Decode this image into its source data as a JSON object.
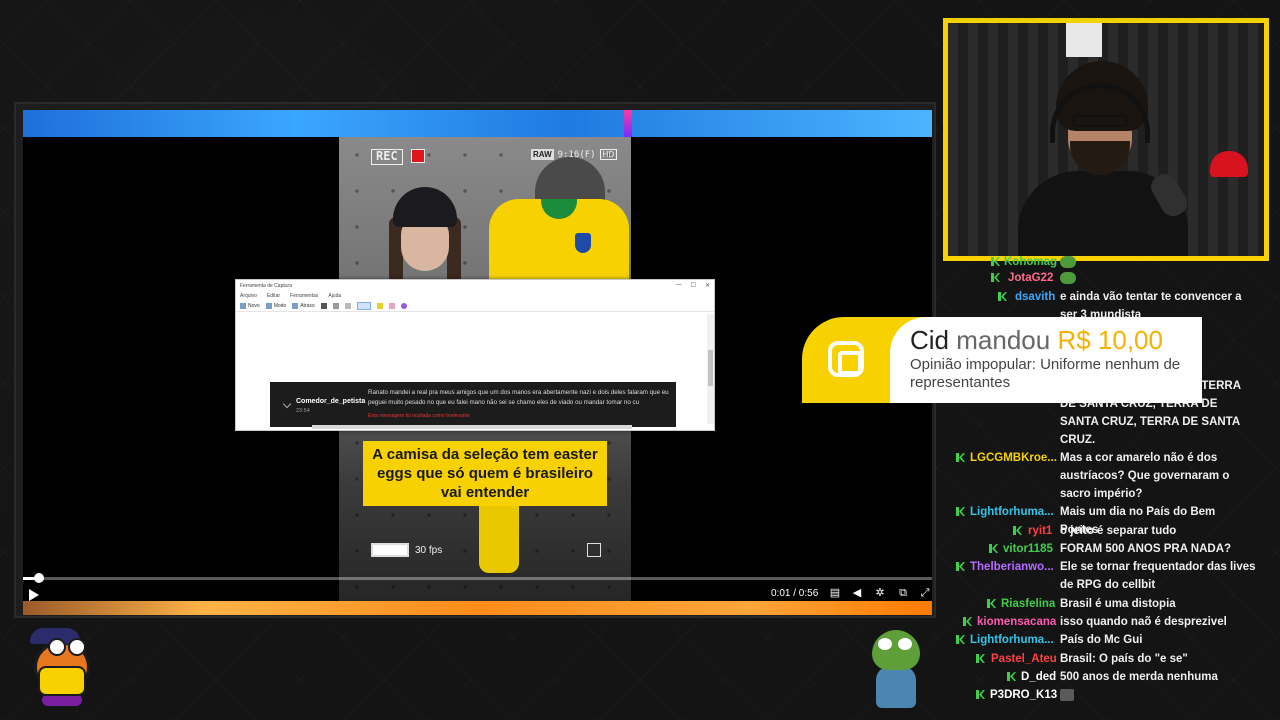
{
  "player": {
    "time": "0:01 / 0:56",
    "progress": 0.018
  },
  "clip": {
    "rec_label": "REC",
    "raw_label": "RAW",
    "fps_top": "9:16(F)",
    "hd_label": "HD",
    "caption": "A camisa da seleção tem easter eggs que só quem é brasileiro vai entender",
    "fps_bottom": "30 fps"
  },
  "snip": {
    "title": "Ferramenta de Captura",
    "menu": [
      "Arquivo",
      "Editar",
      "Ferramentas",
      "Ajuda"
    ],
    "toolbar": {
      "new": "Novo",
      "mode": "Modo",
      "delay": "Atraso"
    },
    "comment": {
      "user": "Comedor_de_petista",
      "date": "23:54",
      "text": "Ranato mandei a real pra meus amigos que um dos manos era abertamente nazi e dois deles falaram que eu peguei muito pesado no que eu falei mano não sei se chamo eles de viado ou mandar tomar no cu",
      "note": "Esta mensagem foi ocultada como Irrelevante"
    }
  },
  "alert": {
    "name": "Cid",
    "verb": "mandou",
    "amount": "R$ 10,00",
    "message": "Opinião impopular: Uniforme nenhum de representantes"
  },
  "chat": [
    {
      "user": "Kohomag",
      "color": "#3ecf4c",
      "text": ""
    },
    {
      "user": "JotaG22",
      "color": "#ff6a8a",
      "text": ""
    },
    {
      "user": "dsavith",
      "color": "#39a8ff",
      "text": "e ainda vão tentar te convencer a ser 3 mundista"
    },
    {
      "user": "",
      "color": "#ffffff",
      "text": "TERRA DE SANTA CRUZ, TERRA DE SANTA CRUZ, TERRA DE SANTA CRUZ, TERRA DE SANTA CRUZ."
    },
    {
      "user": "LGCGMBKroe...",
      "color": "#f7d100",
      "text": "Mas a cor amarelo não é dos austríacos? Que governaram o sacro império?"
    },
    {
      "user": "Lightforhuma...",
      "color": "#33c5e8",
      "text": "Mais um dia no País do Bem Pontes"
    },
    {
      "user": "ryit1",
      "color": "#ff4040",
      "text": "o jeito é separar tudo"
    },
    {
      "user": "vitor1185",
      "color": "#3ecf4c",
      "text": "FORAM 500 ANOS PRA NADA?"
    },
    {
      "user": "Thelberianwo...",
      "color": "#b86bff",
      "text": "Ele se tornar frequentador das lives de RPG do cellbit"
    },
    {
      "user": "Riasfelina",
      "color": "#3ecf4c",
      "text": "Brasil é uma distopia"
    },
    {
      "user": "kiomensacana",
      "color": "#ff5ab4",
      "text": "isso quando naõ é desprezivel"
    },
    {
      "user": "Lightforhuma...",
      "color": "#33c5e8",
      "text": "País do Mc Gui"
    },
    {
      "user": "Pastel_Ateu",
      "color": "#ff4040",
      "text": "Brasil: O país do \"e se\""
    },
    {
      "user": "D_ded",
      "color": "#ffffff",
      "text": "500 anos de merda nenhuma"
    },
    {
      "user": "P3DRO_K13",
      "color": "#ffffff",
      "text": ""
    }
  ],
  "colors": {
    "accent": "#f7d100",
    "background": "#141414",
    "badge": "#3ecf4c"
  },
  "icons": [
    "play-icon",
    "subtitles-icon",
    "volume-icon",
    "settings-icon",
    "miniplayer-icon",
    "fullscreen-icon",
    "record-dot-icon",
    "document-icon",
    "livepix-logo-icon",
    "sub-badge-icon"
  ]
}
